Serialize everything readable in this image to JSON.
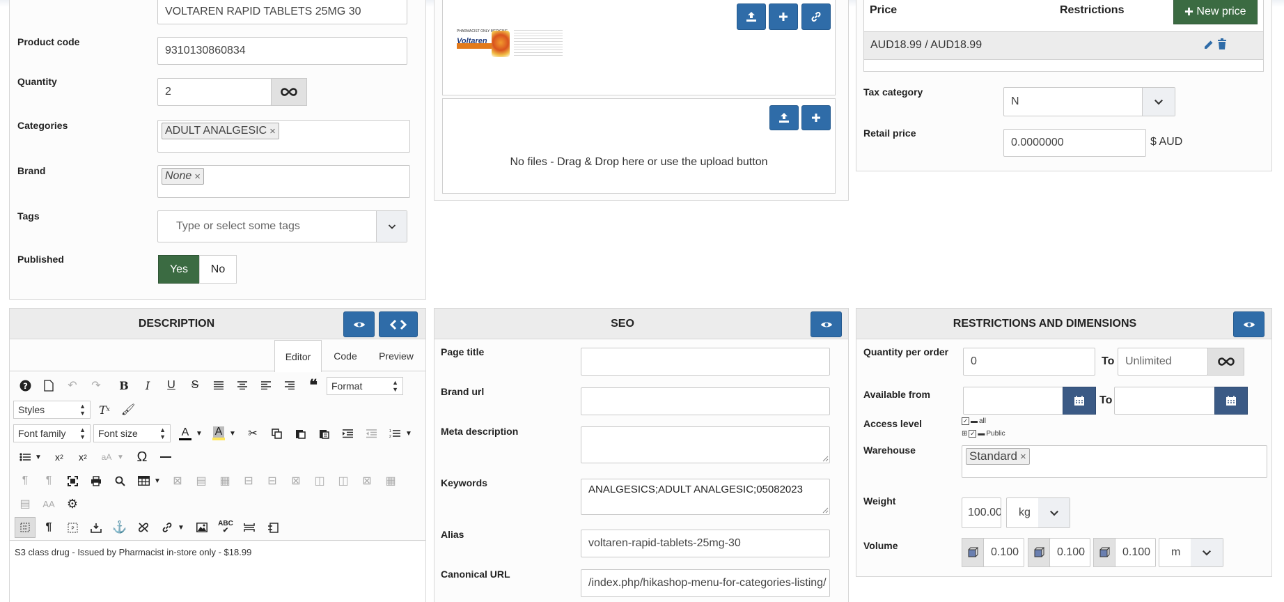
{
  "product": {
    "name_value": "VOLTAREN RAPID TABLETS 25MG 30",
    "code_label": "Product code",
    "code_value": "9310130860834",
    "quantity_label": "Quantity",
    "quantity_value": "2",
    "categories_label": "Categories",
    "categories": [
      "ADULT ANALGESIC"
    ],
    "brand_label": "Brand",
    "brand_value": "None",
    "tags_label": "Tags",
    "tags_placeholder": "Type or select some tags",
    "published_label": "Published",
    "published_yes": "Yes",
    "published_no": "No"
  },
  "images": {
    "no_files_text": "No files - Drag & Drop here or use the upload button",
    "thumb_header": "PHARMACIST ONLY MEDICINE",
    "thumb_brand": "Voltaren",
    "thumb_sub": "Rapid 25"
  },
  "pricing": {
    "price_col": "Price",
    "restrictions_col": "Restrictions",
    "new_price_label": "New price",
    "price_row_value": "AUD18.99 / AUD18.99",
    "tax_label": "Tax category",
    "tax_value": "N",
    "retail_label": "Retail price",
    "retail_value": "0.0000000",
    "retail_unit": "$ AUD"
  },
  "description": {
    "title": "DESCRIPTION",
    "tabs": [
      "Editor",
      "Code",
      "Preview"
    ],
    "format_select": "Format",
    "styles_select": "Styles",
    "font_family_select": "Font family",
    "font_size_select": "Font size",
    "content_text": "S3 class drug - Issued by Pharmacist in-store only - $18.99"
  },
  "seo": {
    "title": "SEO",
    "page_title_label": "Page title",
    "page_title_value": "",
    "brand_url_label": "Brand url",
    "brand_url_value": "",
    "meta_desc_label": "Meta description",
    "meta_desc_value": "",
    "keywords_label": "Keywords",
    "keywords_value": "ANALGESICS;ADULT ANALGESIC;05082023",
    "alias_label": "Alias",
    "alias_value": "voltaren-rapid-tablets-25mg-30",
    "canonical_label": "Canonical URL",
    "canonical_value": "/index.php/hikashop-menu-for-categories-listing/"
  },
  "restrictions": {
    "title": "RESTRICTIONS AND DIMENSIONS",
    "qty_per_order_label": "Quantity per order",
    "qty_min_value": "0",
    "to_label": "To",
    "qty_max_placeholder": "Unlimited",
    "available_from_label": "Available from",
    "access_level_label": "Access level",
    "access_all": "all",
    "access_public": "Public",
    "warehouse_label": "Warehouse",
    "warehouse_value": "Standard",
    "weight_label": "Weight",
    "weight_value": "100.000",
    "weight_unit": "kg",
    "volume_label": "Volume",
    "volume_values": [
      "0.100",
      "0.100",
      "0.100"
    ],
    "volume_unit": "m"
  },
  "colors": {
    "accent_blue": "#2f6ca8",
    "published_green": "#3b6b42",
    "new_price_green": "#3b6b42"
  }
}
